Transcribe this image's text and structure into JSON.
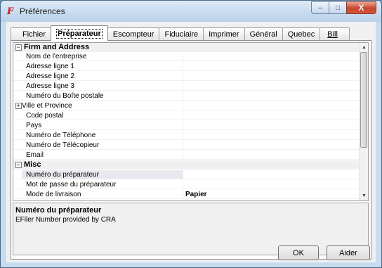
{
  "window": {
    "title": "Préférences",
    "close_glyph": "X",
    "minimize_glyph": "–",
    "maximize_glyph": "□"
  },
  "tabs": [
    {
      "label": "Fichier",
      "active": false
    },
    {
      "label": "Préparateur",
      "active": true
    },
    {
      "label": "Escompteur",
      "active": false
    },
    {
      "label": "Fiduciaire",
      "active": false
    },
    {
      "label": "Imprimer",
      "active": false
    },
    {
      "label": "Général",
      "active": false
    },
    {
      "label": "Quebec",
      "active": false
    },
    {
      "label": "Bill",
      "active": false
    }
  ],
  "grid": {
    "categories": {
      "firm": "Firm and Address",
      "misc": "Misc"
    },
    "rows": {
      "nom_entreprise": {
        "name": "Nom de l'entreprise",
        "value": ""
      },
      "adresse1": {
        "name": "Adresse ligne 1",
        "value": ""
      },
      "adresse2": {
        "name": "Adresse ligne 2",
        "value": ""
      },
      "adresse3": {
        "name": "Adresse ligne 3",
        "value": ""
      },
      "boite_postale": {
        "name": "Numéro du Boîte postale",
        "value": ""
      },
      "ville_province": {
        "name": "Ville et Province",
        "value": ""
      },
      "code_postal": {
        "name": "Code postal",
        "value": ""
      },
      "pays": {
        "name": "Pays",
        "value": ""
      },
      "telephone": {
        "name": "Numéro de Téléphone",
        "value": ""
      },
      "telecopieur": {
        "name": "Numéro de Télécopieur",
        "value": ""
      },
      "email": {
        "name": "Email",
        "value": ""
      },
      "num_preparateur": {
        "name": "Numéro du préparateur",
        "value": ""
      },
      "mot_de_passe": {
        "name": "Mot de passe du préparateur",
        "value": ""
      },
      "mode_livraison": {
        "name": "Mode de livraison",
        "value": "Papier"
      }
    }
  },
  "help": {
    "title": "Numéro du préparateur",
    "description": "EFiler Number provided by CRA"
  },
  "buttons": {
    "ok": "OK",
    "help": "Aider"
  },
  "colors": {
    "titlebar": "#c9dcef",
    "close_button": "#c7462c",
    "category_background": "#f0f0f0"
  }
}
